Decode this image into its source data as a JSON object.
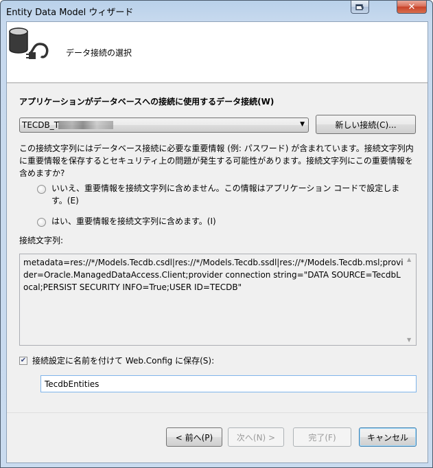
{
  "window": {
    "title": "Entity Data Model ウィザード",
    "close_glyph": "✕"
  },
  "header": {
    "title": "データ接続の選択",
    "icon": "database-plug-icon"
  },
  "connection": {
    "label": "アプリケーションがデータベースへの接続に使用するデータ接続(W)",
    "selected_value": "TECDB_T",
    "dropdown_arrow": "▼",
    "new_connection_label": "新しい接続(C)..."
  },
  "sensitive": {
    "description": "この接続文字列にはデータベース接続に必要な重要情報 (例: パスワード) が含まれています。接続文字列内に重要情報を保存するとセキュリティ上の問題が発生する可能性があります。接続文字列にこの重要情報を含めますか?",
    "option_no": "いいえ、重要情報を接続文字列に含めません。この情報はアプリケーション コードで設定します。(E)",
    "option_yes": "はい、重要情報を接続文字列に含めます。(I)"
  },
  "connection_string": {
    "label": "接続文字列:",
    "value": "metadata=res://*/Models.Tecdb.csdl|res://*/Models.Tecdb.ssdl|res://*/Models.Tecdb.msl;provider=Oracle.ManagedDataAccess.Client;provider connection string=\"DATA SOURCE=TecdbLocal;PERSIST SECURITY INFO=True;USER ID=TECDB\"",
    "scroll_up_glyph": "▲",
    "scroll_down_glyph": "▼"
  },
  "save": {
    "checkbox_label": "接続設定に名前を付けて Web.Config に保存(S):",
    "checked": true,
    "check_glyph": "✔",
    "entity_name": "TecdbEntities"
  },
  "footer": {
    "back_label": "< 前へ(P)",
    "next_label": "次へ(N) >",
    "finish_label": "完了(F)",
    "cancel_label": "キャンセル"
  }
}
